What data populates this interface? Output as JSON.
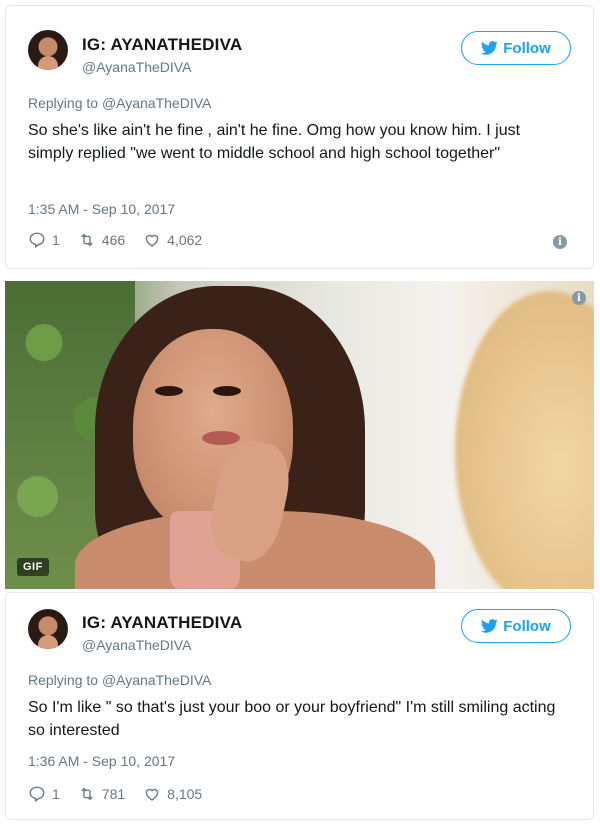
{
  "tweets": [
    {
      "name": "IG: AYANATHEDIVA",
      "handle": "@AyanaTheDIVA",
      "follow_label": "Follow",
      "replying_prefix": "Replying to",
      "replying_to": "@AyanaTheDIVA",
      "text": "So she's like ain't he fine , ain't he fine. Omg how you know him. I just simply replied \"we went to middle school and high school together\"",
      "timestamp": "1:35 AM - Sep 10, 2017",
      "replies": "1",
      "retweets": "466",
      "likes": "4,062",
      "info_glyph": "i"
    },
    {
      "name": "IG: AYANATHEDIVA",
      "handle": "@AyanaTheDIVA",
      "follow_label": "Follow",
      "replying_prefix": "Replying to",
      "replying_to": "@AyanaTheDIVA",
      "text": "So I'm like \" so that's just your boo or your boyfriend\" I'm still smiling acting so interested",
      "timestamp": "1:36 AM - Sep 10, 2017",
      "replies": "1",
      "retweets": "781",
      "likes": "8,105"
    }
  ],
  "gif": {
    "badge": "GIF",
    "info_glyph": "i"
  },
  "colors": {
    "accent": "#1da1f2",
    "muted": "#657786",
    "text": "#14171a",
    "border": "#e1e8ed"
  },
  "icons": [
    "twitter-bird-icon",
    "reply-icon",
    "retweet-icon",
    "like-heart-icon",
    "info-icon"
  ]
}
